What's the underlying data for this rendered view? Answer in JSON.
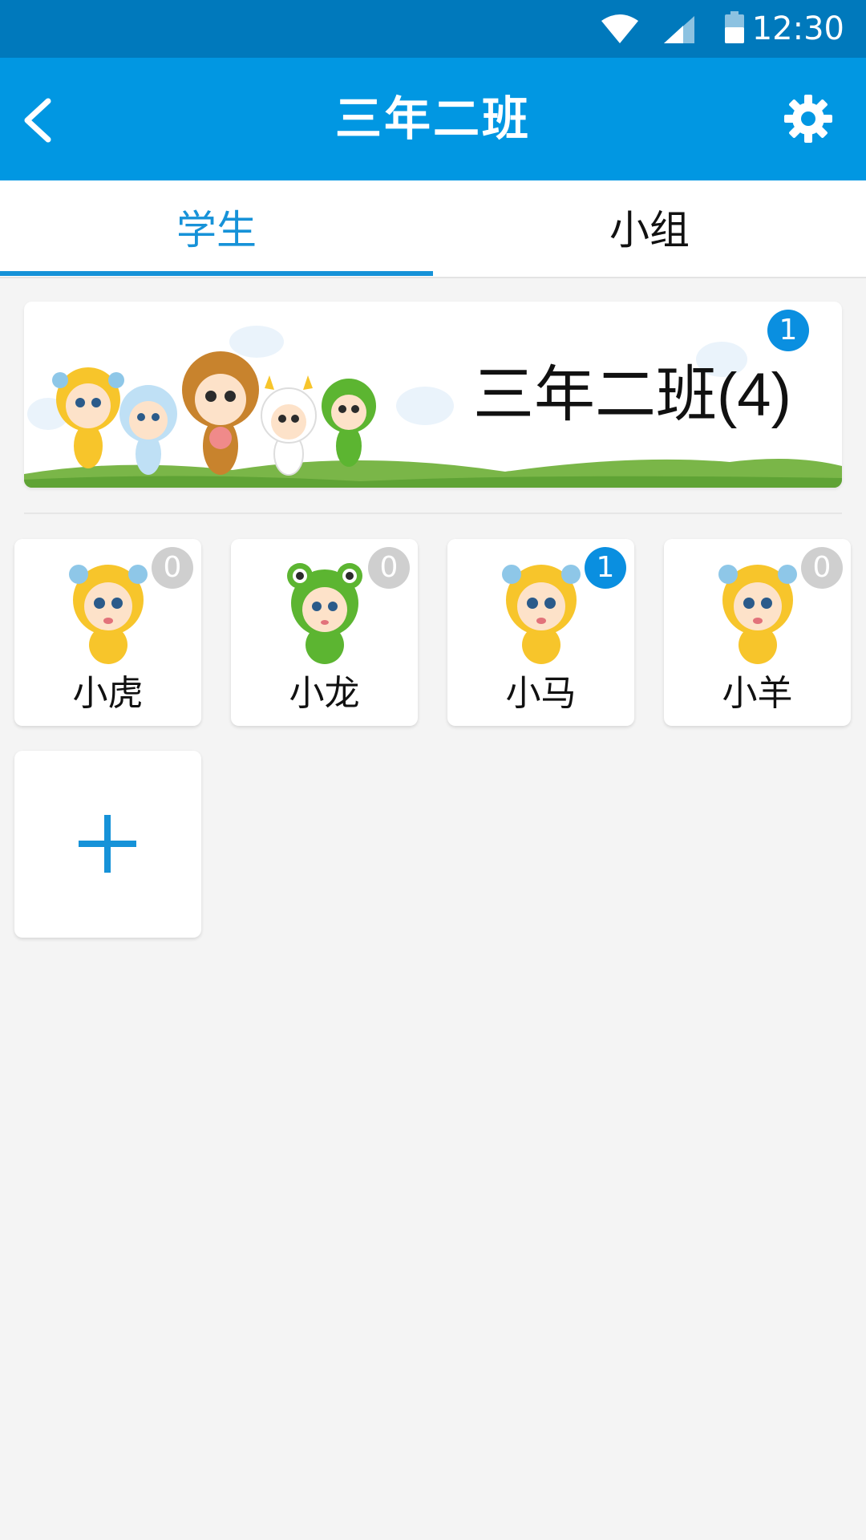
{
  "status_bar": {
    "time": "12:30",
    "icons": [
      "wifi-icon",
      "signal-icon",
      "battery-icon"
    ]
  },
  "app_bar": {
    "title": "三年二班",
    "back_icon": "chevron-left-icon",
    "settings_icon": "gear-icon"
  },
  "tabs": [
    {
      "label": "学生",
      "active": true
    },
    {
      "label": "小组",
      "active": false
    }
  ],
  "class_banner": {
    "title": "三年二班(4)",
    "badge": "1"
  },
  "students": [
    {
      "name": "小虎",
      "badge": "0",
      "avatar": "tiger-avatar-icon"
    },
    {
      "name": "小龙",
      "badge": "0",
      "avatar": "frog-avatar-icon"
    },
    {
      "name": "小马",
      "badge": "1",
      "avatar": "tiger-avatar-icon"
    },
    {
      "name": "小羊",
      "badge": "0",
      "avatar": "tiger-avatar-icon"
    }
  ],
  "colors": {
    "status_bar": "#0079bc",
    "app_bar": "#0197e2",
    "accent": "#1692d8",
    "badge_active": "#0a8fe0",
    "badge_inactive": "#cfcfcf",
    "background": "#f4f4f4"
  }
}
